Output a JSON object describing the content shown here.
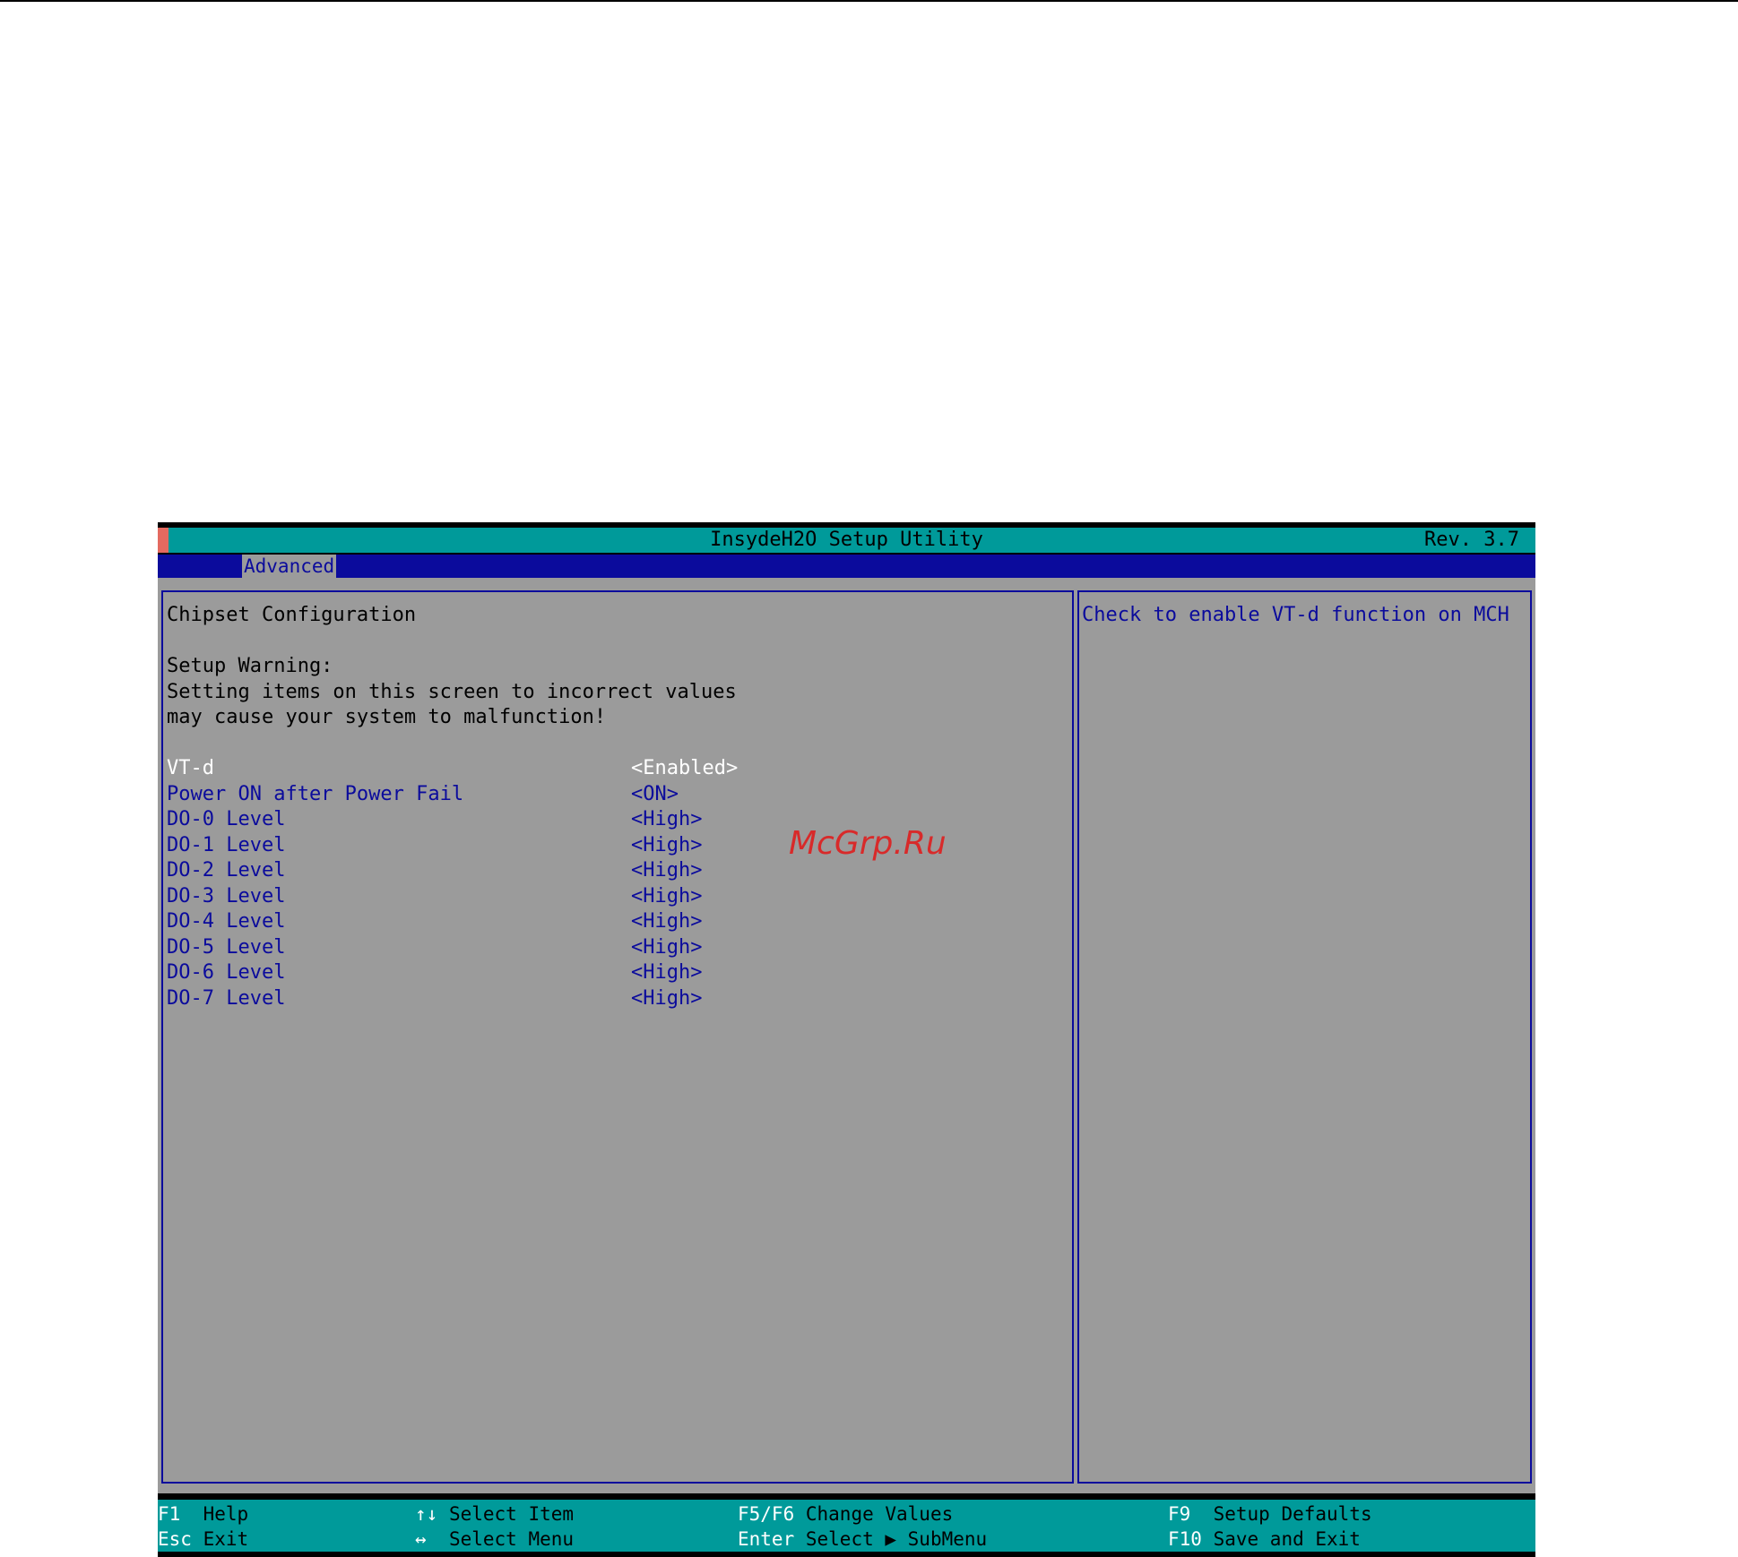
{
  "header": {
    "title": "InsydeH2O Setup Utility",
    "rev": "Rev. 3.7"
  },
  "menu": {
    "active_tab": "Advanced"
  },
  "main": {
    "section_title": "Chipset Configuration",
    "warning_title": "Setup Warning:",
    "warning_line1": "Setting items on this screen to incorrect values",
    "warning_line2": "may cause your system to malfunction!",
    "items": [
      {
        "label": "VT-d",
        "value": "<Enabled>",
        "selected": true
      },
      {
        "label": "Power ON after Power Fail",
        "value": "<ON>"
      },
      {
        "label": "DO-0 Level",
        "value": "<High>"
      },
      {
        "label": "DO-1 Level",
        "value": "<High>"
      },
      {
        "label": "DO-2 Level",
        "value": "<High>"
      },
      {
        "label": "DO-3 Level",
        "value": "<High>"
      },
      {
        "label": "DO-4 Level",
        "value": "<High>"
      },
      {
        "label": "DO-5 Level",
        "value": "<High>"
      },
      {
        "label": "DO-6 Level",
        "value": "<High>"
      },
      {
        "label": "DO-7 Level",
        "value": "<High>"
      }
    ]
  },
  "help": {
    "text": "Check to enable VT-d function on MCH"
  },
  "watermark": "McGrp.Ru",
  "footer": {
    "f1_key": "F1",
    "f1_desc": "Help",
    "esc_key": "Esc",
    "esc_desc": "Exit",
    "updown_key": "↑↓",
    "updown_desc": "Select Item",
    "leftright_key": "↔",
    "leftright_desc": "Select Menu",
    "f5f6_key": "F5/F6",
    "f5f6_desc": "Change Values",
    "enter_key": "Enter",
    "enter_desc": "Select ▶ SubMenu",
    "f9_key": "F9",
    "f9_desc": "Setup Defaults",
    "f10_key": "F10",
    "f10_desc": "Save and Exit"
  },
  "colors": {
    "teal": "#009a9a",
    "navy": "#0b0b9c",
    "panel_gray": "#9b9b9b",
    "accent_red": "#e46a60",
    "watermark_red": "#d82a2a"
  }
}
